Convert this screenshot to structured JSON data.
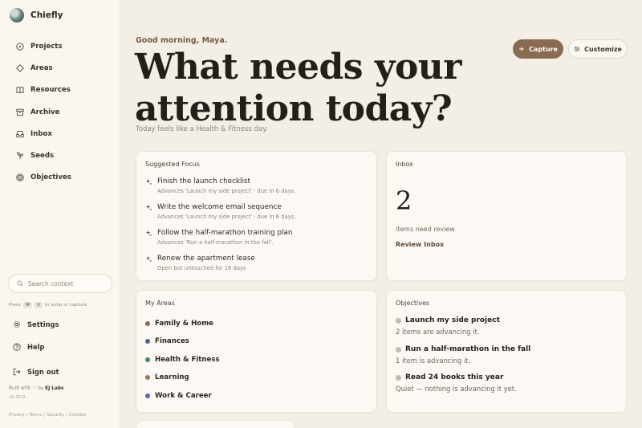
{
  "app": {
    "name": "Chiefly"
  },
  "sidebar": {
    "items": [
      {
        "label": "Projects",
        "icon": "compass-icon"
      },
      {
        "label": "Areas",
        "icon": "diamond-icon"
      },
      {
        "label": "Resources",
        "icon": "book-icon"
      },
      {
        "label": "Archive",
        "icon": "archive-icon"
      },
      {
        "label": "Inbox",
        "icon": "inbox-icon"
      },
      {
        "label": "Seeds",
        "icon": "sprout-icon"
      },
      {
        "label": "Objectives",
        "icon": "target-icon"
      }
    ],
    "search_placeholder": "Search context",
    "hint": {
      "prefix": "Press",
      "key1": "⌘",
      "key2": "K",
      "suffix": "to jump or capture"
    },
    "bottom": [
      {
        "label": "Settings",
        "icon": "gear-icon"
      },
      {
        "label": "Help",
        "icon": "help-icon"
      },
      {
        "label": "Sign out",
        "icon": "sign-out-icon"
      }
    ],
    "built": {
      "prefix": "Built with",
      "suffix": "by",
      "company": "EJ Labs"
    },
    "version": "v0.32.0",
    "legal": {
      "privacy": "Privacy",
      "terms": "Terms",
      "security": "Security",
      "cookies": "Cookies",
      "separator": "|"
    }
  },
  "header": {
    "greeting": "Good morning, Maya.",
    "headline": "What needs your attention today?",
    "subline": "Today feels like a Health & Fitness day.",
    "capture_label": "Capture",
    "customize_label": "Customize"
  },
  "suggested_focus": {
    "title": "Suggested Focus",
    "items": [
      {
        "label": "Finish the launch checklist",
        "sub": "Advances 'Launch my side project' · due in 6 days."
      },
      {
        "label": "Write the welcome email sequence",
        "sub": "Advances 'Launch my side project' · due in 6 days."
      },
      {
        "label": "Follow the half-marathon training plan",
        "sub": "Advances 'Run a half-marathon in the fall'."
      },
      {
        "label": "Renew the apartment lease",
        "sub": "Open but untouched for 18 days"
      }
    ]
  },
  "inbox": {
    "title": "Inbox",
    "count": "2",
    "note": "items need review",
    "link": "Review Inbox"
  },
  "areas": {
    "title": "My Areas",
    "items": [
      {
        "label": "Family & Home",
        "color": "#8a6a50"
      },
      {
        "label": "Finances",
        "color": "#5a5f93"
      },
      {
        "label": "Health & Fitness",
        "color": "#3f8a5a"
      },
      {
        "label": "Learning",
        "color": "#9a7a55"
      },
      {
        "label": "Work & Career",
        "color": "#5a6aa0"
      }
    ]
  },
  "objectives": {
    "title": "Objectives",
    "items": [
      {
        "label": "Launch my side project",
        "sub": "2 items are advancing it."
      },
      {
        "label": "Run a half-marathon in the fall",
        "sub": "1 item is advancing it."
      },
      {
        "label": "Read 24 books this year",
        "sub": "Quiet — nothing is advancing it yet."
      }
    ]
  },
  "colors": {
    "accent": "#8a6a50",
    "background": "#f3eee6",
    "card": "#fcf8f3"
  }
}
